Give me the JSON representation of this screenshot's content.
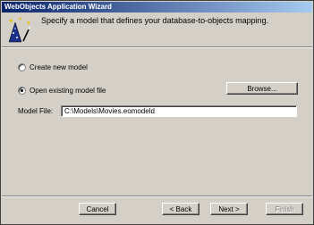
{
  "window": {
    "title": "WebObjects Application Wizard"
  },
  "header": {
    "instruction": "Specify a model that defines your database-to-objects mapping.",
    "icon": "magic-wand-icon"
  },
  "options": {
    "create_new": {
      "label": "Create new model",
      "selected": false
    },
    "open_existing": {
      "label": "Open existing model file",
      "selected": true
    }
  },
  "browse_label": "Browse...",
  "model_file": {
    "label": "Model File:",
    "value": "C:\\Models\\Movies.eomodeld"
  },
  "footer": {
    "cancel_label": "Cancel",
    "back_label": "< Back",
    "next_label": "Next >",
    "finish_label": "Finish"
  }
}
